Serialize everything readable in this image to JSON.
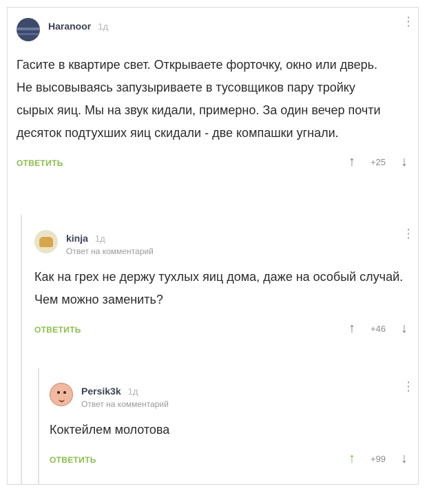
{
  "comments": [
    {
      "user": "Haranoor",
      "time": "1д",
      "reply_to": "",
      "text": "Гасите в квартире свет. Открываете форточку, окно или дверь. Не высовываясь запузыриваете в тусовщиков пару тройку сырых яиц. Мы на звук кидали, примерно. За один вечер почти десяток подтухших яиц скидали - две компашки угнали.",
      "reply_label": "ОТВЕТИТЬ",
      "score": "+25",
      "voted_up": false
    },
    {
      "user": "kinja",
      "time": "1д",
      "reply_to": "Ответ на комментарий",
      "text": "Как на грех не держу тухлых яиц дома, даже на особый случай. Чем можно заменить?",
      "reply_label": "ОТВЕТИТЬ",
      "score": "+46",
      "voted_up": false
    },
    {
      "user": "Persik3k",
      "time": "1д",
      "reply_to": "Ответ на комментарий",
      "text": "Коктейлем молотова",
      "reply_label": "ОТВЕТИТЬ",
      "score": "+99",
      "voted_up": true
    }
  ],
  "icons": {
    "menu": "⋮",
    "upvote": "↑",
    "downvote": "↓"
  },
  "colors": {
    "reply_link": "#8bbf4a",
    "upvote_active": "#7cbf3a"
  }
}
